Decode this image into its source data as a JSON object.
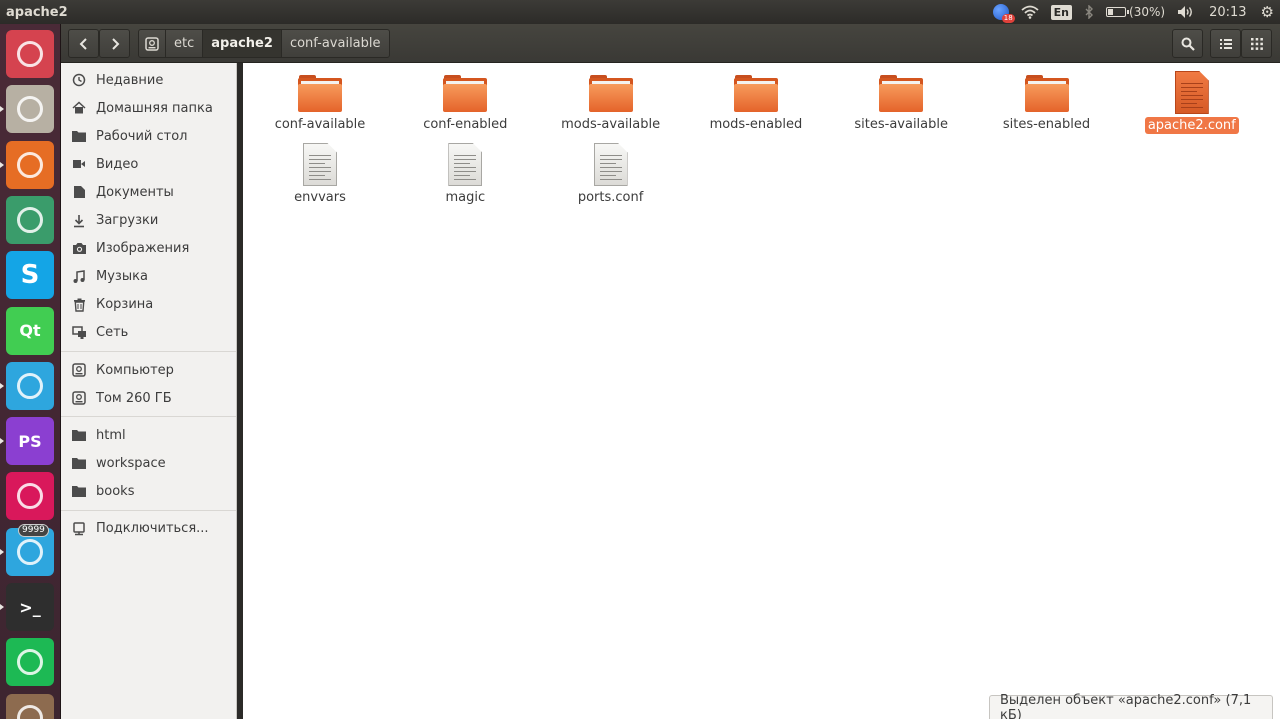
{
  "window": {
    "title": "apache2"
  },
  "panel": {
    "notification_count": "18",
    "language": "En",
    "battery_text": "(30%)",
    "battery_level": 0.3,
    "clock": "20:13"
  },
  "launcher": {
    "items": [
      {
        "name": "ubuntu-dash",
        "glyph": "",
        "color": "#d5434f",
        "running": false
      },
      {
        "name": "files",
        "glyph": "",
        "color": "#b7b0a3",
        "running": true
      },
      {
        "name": "firefox",
        "glyph": "",
        "color": "#e66d24",
        "running": true
      },
      {
        "name": "atom",
        "glyph": "",
        "color": "#3a9c6b",
        "running": false
      },
      {
        "name": "skype",
        "glyph": "S",
        "color": "#14a5e6",
        "running": false
      },
      {
        "name": "qt-creator",
        "glyph": "Qt",
        "color": "#41cd52",
        "running": false
      },
      {
        "name": "telegram",
        "glyph": "",
        "color": "#2ea6de",
        "running": true
      },
      {
        "name": "phpstorm",
        "glyph": "PS",
        "color": "#8b3fd1",
        "running": true
      },
      {
        "name": "gitkraken",
        "glyph": "",
        "color": "#d9185b",
        "running": false
      },
      {
        "name": "telegram-2",
        "glyph": "",
        "color": "#2ea6de",
        "running": true,
        "badge": "9999"
      },
      {
        "name": "terminal",
        "glyph": ">_",
        "color": "#2e2e2e",
        "running": true
      },
      {
        "name": "spotify",
        "glyph": "",
        "color": "#1db954",
        "running": false
      },
      {
        "name": "trash",
        "glyph": "",
        "color": "#8d6b4f",
        "running": false
      }
    ]
  },
  "breadcrumb": [
    "etc",
    "apache2",
    "conf-available"
  ],
  "breadcrumb_active": 1,
  "sidebar": {
    "places": [
      {
        "label": "Недавние",
        "icon": "clock-icon"
      },
      {
        "label": "Домашняя папка",
        "icon": "home-icon"
      },
      {
        "label": "Рабочий стол",
        "icon": "folder-icon"
      },
      {
        "label": "Видео",
        "icon": "video-icon"
      },
      {
        "label": "Документы",
        "icon": "document-icon"
      },
      {
        "label": "Загрузки",
        "icon": "download-icon"
      },
      {
        "label": "Изображения",
        "icon": "camera-icon"
      },
      {
        "label": "Музыка",
        "icon": "music-icon"
      },
      {
        "label": "Корзина",
        "icon": "trash-icon"
      },
      {
        "label": "Сеть",
        "icon": "network-icon"
      }
    ],
    "devices": [
      {
        "label": "Компьютер",
        "icon": "drive-icon"
      },
      {
        "label": "Том 260 ГБ",
        "icon": "drive-icon"
      }
    ],
    "bookmarks": [
      {
        "label": "html",
        "icon": "folder-icon"
      },
      {
        "label": "workspace",
        "icon": "folder-icon"
      },
      {
        "label": "books",
        "icon": "folder-icon"
      }
    ],
    "connect": {
      "label": "Подключиться...",
      "icon": "server-icon"
    }
  },
  "files": [
    {
      "name": "conf-available",
      "type": "folder"
    },
    {
      "name": "conf-enabled",
      "type": "folder"
    },
    {
      "name": "mods-available",
      "type": "folder"
    },
    {
      "name": "mods-enabled",
      "type": "folder"
    },
    {
      "name": "sites-available",
      "type": "folder"
    },
    {
      "name": "sites-enabled",
      "type": "folder"
    },
    {
      "name": "apache2.conf",
      "type": "text",
      "selected": true
    },
    {
      "name": "envvars",
      "type": "text"
    },
    {
      "name": "magic",
      "type": "text"
    },
    {
      "name": "ports.conf",
      "type": "text"
    }
  ],
  "status": {
    "text": "Выделен объект «apache2.conf» (7,1 кБ)"
  }
}
